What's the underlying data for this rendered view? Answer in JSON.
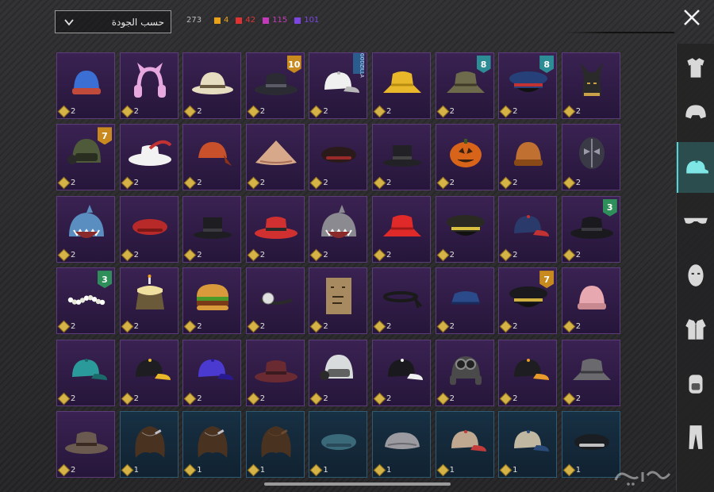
{
  "header": {
    "sort_label": "حسب الجودة",
    "total": "273",
    "counts": [
      {
        "value": "4",
        "color": "#e8a21a"
      },
      {
        "value": "42",
        "color": "#e03232"
      },
      {
        "value": "115",
        "color": "#c23ab8"
      },
      {
        "value": "101",
        "color": "#7a45e0"
      }
    ]
  },
  "sidebar": {
    "items": [
      {
        "name": "outfit-icon",
        "active": false
      },
      {
        "name": "helmet-icon",
        "active": false
      },
      {
        "name": "hat-icon",
        "active": true
      },
      {
        "name": "glasses-icon",
        "active": false
      },
      {
        "name": "mask-icon",
        "active": false
      },
      {
        "name": "jacket-icon",
        "active": false
      },
      {
        "name": "backpack-icon",
        "active": false
      },
      {
        "name": "pants-icon",
        "active": false
      }
    ]
  },
  "items": [
    {
      "name": "knit-beanie",
      "qty": "2",
      "color": "#3b6fd4",
      "accent": "#c24a3a",
      "shape": "beanie"
    },
    {
      "name": "cat-ear-headphones",
      "qty": "2",
      "color": "#e7a8e0",
      "accent": "#f5d3f0",
      "shape": "headphones"
    },
    {
      "name": "pith-helmet",
      "qty": "2",
      "color": "#e6dcc0",
      "accent": "#6a5a40",
      "shape": "pith"
    },
    {
      "name": "fedora-black",
      "qty": "2",
      "color": "#2b2b33",
      "accent": "#5a5a66",
      "shape": "fedora",
      "badge": "10",
      "badge_color": "orange"
    },
    {
      "name": "white-cap",
      "qty": "2",
      "color": "#f0f0f0",
      "accent": "#b8b8b8",
      "shape": "cap",
      "tag": "GODZILLA"
    },
    {
      "name": "yellow-bucket-hat",
      "qty": "2",
      "color": "#e8b82a",
      "accent": "#b88c10",
      "shape": "bucket"
    },
    {
      "name": "camo-boonie",
      "qty": "2",
      "color": "#6e6a4c",
      "accent": "#3e3a28",
      "shape": "bucket",
      "badge": "8",
      "badge_color": "teal"
    },
    {
      "name": "officer-cap-blue",
      "qty": "2",
      "color": "#26407a",
      "accent": "#c23232",
      "shape": "officer",
      "badge": "8",
      "badge_color": "teal"
    },
    {
      "name": "anubis-mask",
      "qty": "2",
      "color": "#2a2a2a",
      "accent": "#c9a24a",
      "shape": "anubis"
    },
    {
      "name": "tactical-helmet-headset",
      "qty": "2",
      "color": "#4e5a3a",
      "accent": "#2a2a2a",
      "shape": "helmet",
      "badge": "7",
      "badge_color": "orange"
    },
    {
      "name": "musketeer-hat",
      "qty": "2",
      "color": "#f2f2f2",
      "accent": "#c23232",
      "shape": "cavalier"
    },
    {
      "name": "bandana-red",
      "qty": "2",
      "color": "#c8502a",
      "accent": "#8a3218",
      "shape": "bandana"
    },
    {
      "name": "conical-straw-hat",
      "qty": "2",
      "color": "#d8a88a",
      "accent": "#a87058",
      "shape": "conical"
    },
    {
      "name": "black-beret-red",
      "qty": "2",
      "color": "#2a1a1a",
      "accent": "#9a2a2a",
      "shape": "beret"
    },
    {
      "name": "top-hat-black",
      "qty": "2",
      "color": "#222226",
      "accent": "#444",
      "shape": "tophat"
    },
    {
      "name": "pumpkin-head",
      "qty": "2",
      "color": "#d8641a",
      "accent": "#3a2010",
      "shape": "pumpkin"
    },
    {
      "name": "orange-beanie",
      "qty": "2",
      "color": "#c07030",
      "accent": "#8a4a18",
      "shape": "beanie"
    },
    {
      "name": "luchador-mask",
      "qty": "2",
      "color": "#3a3a46",
      "accent": "#9a9aaa",
      "shape": "mask"
    },
    {
      "name": "shark-hood",
      "qty": "2",
      "color": "#5a8ec0",
      "accent": "#ffffff",
      "shape": "shark"
    },
    {
      "name": "red-beret",
      "qty": "2",
      "color": "#b82a2a",
      "accent": "#7a1818",
      "shape": "beret"
    },
    {
      "name": "bowler-black",
      "qty": "2",
      "color": "#1e1e22",
      "accent": "#3a3a40",
      "shape": "tophat"
    },
    {
      "name": "red-fedora",
      "qty": "2",
      "color": "#d03030",
      "accent": "#2a2a2a",
      "shape": "fedora"
    },
    {
      "name": "shark-head-gray",
      "qty": "2",
      "color": "#8a8a90",
      "accent": "#ffffff",
      "shape": "shark"
    },
    {
      "name": "red-bucket-hat",
      "qty": "2",
      "color": "#e02a2a",
      "accent": "#a01818",
      "shape": "bucket"
    },
    {
      "name": "police-cap",
      "qty": "2",
      "color": "#2a2a22",
      "accent": "#d8c040",
      "shape": "officer"
    },
    {
      "name": "navy-cap-n",
      "qty": "2",
      "color": "#2a3a6a",
      "accent": "#c23232",
      "shape": "cap"
    },
    {
      "name": "black-fedora-gold",
      "qty": "2",
      "color": "#1a1a1e",
      "accent": "#3a3a40",
      "shape": "fedora",
      "badge": "3",
      "badge_color": "green"
    },
    {
      "name": "flower-crown",
      "qty": "2",
      "color": "#ffffff",
      "accent": "#e8e8d8",
      "shape": "crown",
      "badge": "3",
      "badge_color": "green"
    },
    {
      "name": "cake-hat",
      "qty": "2",
      "color": "#6a5a3a",
      "accent": "#f0e0a0",
      "shape": "cake"
    },
    {
      "name": "burger-hat",
      "qty": "2",
      "color": "#d89a3a",
      "accent": "#7a3a18",
      "shape": "burger"
    },
    {
      "name": "head-mirror",
      "qty": "2",
      "color": "#2a2a2a",
      "accent": "#e0e0e0",
      "shape": "mirror"
    },
    {
      "name": "paper-bag-mask",
      "qty": "2",
      "color": "#a88a60",
      "accent": "#3a2a18",
      "shape": "bag"
    },
    {
      "name": "headband-black",
      "qty": "2",
      "color": "#1a1a1a",
      "accent": "#3a3a3a",
      "shape": "band"
    },
    {
      "name": "blue-garrison-cap",
      "qty": "2",
      "color": "#2a4a8a",
      "accent": "#1a2a5a",
      "shape": "garrison"
    },
    {
      "name": "captain-hat",
      "qty": "2",
      "color": "#1a1a1e",
      "accent": "#d0b040",
      "shape": "officer",
      "badge": "7",
      "badge_color": "orange"
    },
    {
      "name": "pink-beanie",
      "qty": "2",
      "color": "#e8a8b0",
      "accent": "#c88890",
      "shape": "beanie"
    },
    {
      "name": "teal-cap",
      "qty": "2",
      "color": "#2a9a9a",
      "accent": "#1a6a6a",
      "shape": "cap"
    },
    {
      "name": "black-cap-yellow",
      "qty": "2",
      "color": "#1e1e22",
      "accent": "#e8b82a",
      "shape": "cap"
    },
    {
      "name": "purple-cap",
      "qty": "2",
      "color": "#4a3ad0",
      "accent": "#2a1a90",
      "shape": "cap"
    },
    {
      "name": "maroon-fedora",
      "qty": "2",
      "color": "#6a2a32",
      "accent": "#3a1a1e",
      "shape": "fedora"
    },
    {
      "name": "checkered-helmet",
      "qty": "2",
      "color": "#d8dcdc",
      "accent": "#2a2a2a",
      "shape": "helmet"
    },
    {
      "name": "black-cap-white",
      "qty": "2",
      "color": "#1a1a1e",
      "accent": "#f0f0f0",
      "shape": "cap"
    },
    {
      "name": "aviator-cap-goggles",
      "qty": "2",
      "color": "#4a4a4a",
      "accent": "#8a8a8a",
      "shape": "aviator"
    },
    {
      "name": "flame-cap",
      "qty": "2",
      "color": "#1e1e22",
      "accent": "#e89a2a",
      "shape": "cap"
    },
    {
      "name": "camo-bush-hat",
      "qty": "2",
      "color": "#6a6a6e",
      "accent": "#3a3a3e",
      "shape": "bucket"
    },
    {
      "name": "cowboy-hat-brown",
      "qty": "2",
      "color": "#6a5a50",
      "accent": "#3a2a22",
      "shape": "fedora"
    },
    {
      "name": "brown-hair-clip",
      "qty": "1",
      "color": "#4a3220",
      "accent": "#c0c0c8",
      "shape": "hair",
      "blue": true
    },
    {
      "name": "brown-hair-clip-2",
      "qty": "1",
      "color": "#4a3220",
      "accent": "#c0c0c8",
      "shape": "hair",
      "blue": true
    },
    {
      "name": "brown-hair-3",
      "qty": "1",
      "color": "#4a3220",
      "accent": "#6a4a30",
      "shape": "hair",
      "blue": true
    },
    {
      "name": "teal-beret",
      "qty": "1",
      "color": "#3a6a7a",
      "accent": "#2a4a5a",
      "shape": "beret",
      "blue": true
    },
    {
      "name": "gray-flat-cap",
      "qty": "1",
      "color": "#9a9aa0",
      "accent": "#6a6a70",
      "shape": "flatcap",
      "blue": true
    },
    {
      "name": "trucker-cap-red",
      "qty": "1",
      "color": "#c0a890",
      "accent": "#c23a3a",
      "shape": "cap",
      "blue": true
    },
    {
      "name": "trucker-cap-blue",
      "qty": "1",
      "color": "#c0b8a0",
      "accent": "#2a4a7a",
      "shape": "cap",
      "blue": true
    },
    {
      "name": "black-beret-badge",
      "qty": "1",
      "color": "#1a1e22",
      "accent": "#c0c0c0",
      "shape": "beret",
      "blue": true
    }
  ]
}
